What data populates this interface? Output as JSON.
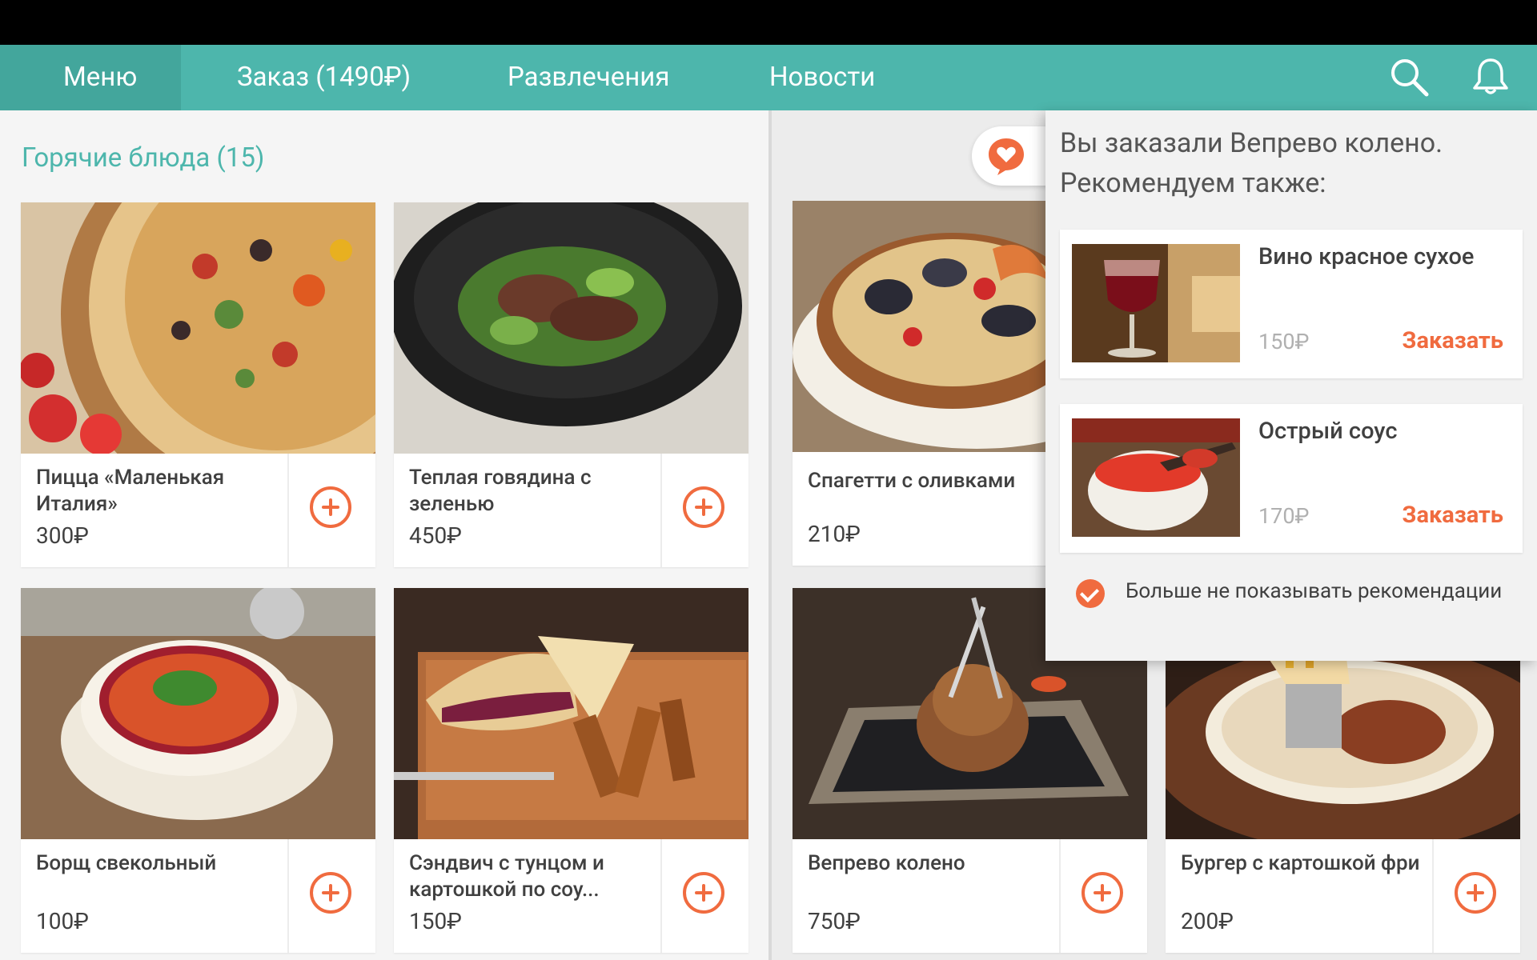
{
  "nav": {
    "menu_label": "Меню",
    "order_label": "Заказ (1490₽)",
    "entertainment_label": "Развлечения",
    "news_label": "Новости"
  },
  "section": {
    "title": "Горячие блюда (15)"
  },
  "dishes": [
    {
      "name": "Пицца «Маленькая Италия»",
      "price": "300₽"
    },
    {
      "name": "Теплая говядина с зеленью",
      "price": "450₽"
    },
    {
      "name": "Спагетти с оливками",
      "price": "210₽"
    },
    {
      "name": "Борщ свекольный",
      "price": "100₽"
    },
    {
      "name": "Сэндвич с тунцом и картошкой по соу...",
      "price": "150₽"
    },
    {
      "name": "Вепрево колено",
      "price": "750₽"
    },
    {
      "name": "Бургер с картошкой фри",
      "price": "200₽"
    }
  ],
  "popup": {
    "message": "Вы заказали Вепрево колено. Рекомендуем также:",
    "recommendations": [
      {
        "name": "Вино красное сухое",
        "price": "150₽",
        "action": "Заказать"
      },
      {
        "name": "Острый соус",
        "price": "170₽",
        "action": "Заказать"
      }
    ],
    "option_label": "Больше не показывать рекомендации",
    "option_checked": true
  },
  "colors": {
    "accent": "#4db6ac",
    "action": "#f06b3f"
  }
}
